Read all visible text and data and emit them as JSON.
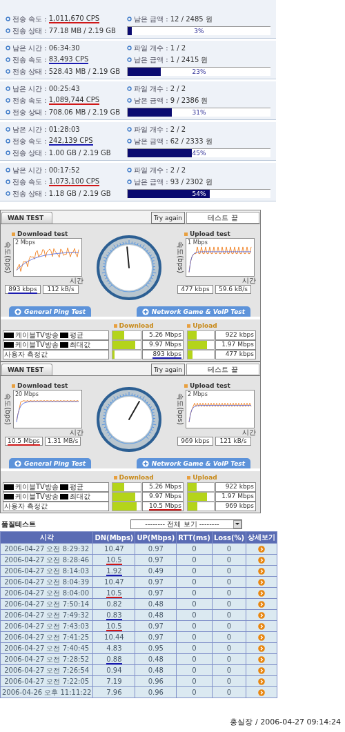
{
  "transfers": [
    {
      "speed_label": "전송 속도 :",
      "speed": {
        "text": "1,011,670 CPS",
        "color": "#d01818"
      },
      "money_label": "남은 금액 :",
      "money": "12 / 2485 원",
      "status_label": "전송 상태 :",
      "status": "77.18 MB / 2.19 GB",
      "level": 0.03,
      "percent": "3%"
    },
    {
      "time_label": "남은 시간 :",
      "time": "06:34:30",
      "files_label": "파일 개수 :",
      "files": "1 / 2",
      "speed_label": "전송 속도 :",
      "speed": {
        "text": "83,493 CPS",
        "color": "#1a1ab0"
      },
      "money_label": "남은 금액 :",
      "money": "1 / 2415 원",
      "status_label": "전송 상태 :",
      "status": "528.43 MB / 2.19 GB",
      "level": 0.23,
      "percent": "23%"
    },
    {
      "time_label": "남은 시간 :",
      "time": "00:25:43",
      "files_label": "파일 개수 :",
      "files": "2 / 2",
      "speed_label": "전송 속도 :",
      "speed": {
        "text": "1,089,744 CPS",
        "color": "#d01818"
      },
      "money_label": "남은 금액 :",
      "money": "9 / 2386 원",
      "status_label": "전송 상태 :",
      "status": "708.06 MB / 2.19 GB",
      "level": 0.31,
      "percent": "31%"
    },
    {
      "time_label": "남은 시간 :",
      "time": "01:28:03",
      "files_label": "파일 개수 :",
      "files": "2 / 2",
      "speed_label": "전송 속도 :",
      "speed": {
        "text": "242,139 CPS",
        "color": "#1a1ab0"
      },
      "money_label": "남은 금액 :",
      "money": "62 / 2333 원",
      "status_label": "전송 상태 :",
      "status": "1.00 GB / 2.19 GB",
      "level": 0.45,
      "percent": "45%"
    },
    {
      "time_label": "남은 시간 :",
      "time": "00:17:52",
      "files_label": "파일 개수 :",
      "files": "2 / 2",
      "speed_label": "전송 속도 :",
      "speed": {
        "text": "1,073,100 CPS",
        "color": "#d01818"
      },
      "money_label": "남은 금액 :",
      "money": "93 / 2302 원",
      "status_label": "전송 상태 :",
      "status": "1.18 GB / 2.19 GB",
      "level": 0.54,
      "percent": "54%"
    }
  ],
  "wan_tests": [
    {
      "tab": "WAN TEST",
      "try_again": "Try again",
      "status": "테스트 끝",
      "gauge": {
        "level": 0.48
      },
      "download": {
        "title": "Download test",
        "scale": "2 Mbps",
        "axis_y": "속도(bps)",
        "axis_x": "시간",
        "kind": "ramp",
        "rate": {
          "text": "893 kbps",
          "color": "#1a1ab0"
        },
        "bytes": "112 kB/s"
      },
      "upload": {
        "title": "Upload test",
        "scale": "1 Mbps",
        "axis_y": "속도(bps)",
        "axis_x": "시간",
        "kind": "pulse",
        "rate": {
          "text": "477 kbps"
        },
        "bytes": "59.6 kB/s"
      },
      "ping_tab": "General Ping Test",
      "game_tab": "Network Game & VoIP Test",
      "download_title": "Download",
      "upload_title": "Upload",
      "rows": [
        {
          "label": "케이블TV방송",
          "suffix": "평균",
          "redacted": true,
          "down": {
            "level": 0.42,
            "text": "5.26 Mbps"
          },
          "up": {
            "level": 0.35,
            "text": "922 kbps"
          }
        },
        {
          "label": "케이블TV방송",
          "suffix": "최대값",
          "redacted": true,
          "down": {
            "level": 0.8,
            "text": "9.97 Mbps"
          },
          "up": {
            "level": 0.75,
            "text": "1.97 Mbps"
          }
        },
        {
          "label": "사용자 측정값",
          "redacted": false,
          "down": {
            "level": 0.07,
            "text": "893 kbps",
            "color": "#1a1ab0"
          },
          "up": {
            "level": 0.18,
            "text": "477 kbps"
          }
        }
      ]
    },
    {
      "tab": "WAN TEST",
      "try_again": "Try again",
      "status": "테스트 끝",
      "gauge": {
        "level": 0.61
      },
      "download": {
        "title": "Download test",
        "scale": "20 Mbps",
        "axis_y": "속도(bps)",
        "axis_x": "시간",
        "kind": "flat",
        "rate": {
          "text": "10.5 Mbps",
          "color": "#d01818"
        },
        "bytes": "1.31 MB/s"
      },
      "upload": {
        "title": "Upload test",
        "scale": "2 Mbps",
        "axis_y": "속도(bps)",
        "axis_x": "시간",
        "kind": "ripple",
        "rate": {
          "text": "969 kbps"
        },
        "bytes": "121 kB/s"
      },
      "ping_tab": "General Ping Test",
      "game_tab": "Network Game & VoIP Test",
      "download_title": "Download",
      "upload_title": "Upload",
      "rows": [
        {
          "label": "케이블TV방송",
          "suffix": "평균",
          "redacted": true,
          "down": {
            "level": 0.42,
            "text": "5.26 Mbps"
          },
          "up": {
            "level": 0.35,
            "text": "922 kbps"
          }
        },
        {
          "label": "케이블TV방송",
          "suffix": "최대값",
          "redacted": true,
          "down": {
            "level": 0.8,
            "text": "9.97 Mbps"
          },
          "up": {
            "level": 0.75,
            "text": "1.97 Mbps"
          }
        },
        {
          "label": "사용자 측정값",
          "redacted": false,
          "down": {
            "level": 0.85,
            "text": "10.5 Mbps",
            "color": "#d01818"
          },
          "up": {
            "level": 0.38,
            "text": "969 kbps"
          }
        }
      ]
    }
  ],
  "quality": {
    "title": "품질테스트",
    "filter": "-------- 전체 보기 --------",
    "columns": [
      "시각",
      "DN(Mbps)",
      "UP(Mbps)",
      "RTT(ms)",
      "Loss(%)",
      "상세보기"
    ],
    "rows": [
      {
        "time": "2006-04-27 오전 8:29:32",
        "dn": {
          "text": "10.47"
        },
        "up": "0.97",
        "rtt": "0",
        "loss": "0"
      },
      {
        "time": "2006-04-27 오전 8:28:46",
        "dn": {
          "text": "10.5",
          "color": "#d01818"
        },
        "up": "0.97",
        "rtt": "0",
        "loss": "0"
      },
      {
        "time": "2006-04-27 오전 8:14:03",
        "dn": {
          "text": "1.92",
          "color": "#1a1ab0"
        },
        "up": "0.49",
        "rtt": "0",
        "loss": "0"
      },
      {
        "time": "2006-04-27 오전 8:04:39",
        "dn": {
          "text": "10.47"
        },
        "up": "0.97",
        "rtt": "0",
        "loss": "0"
      },
      {
        "time": "2006-04-27 오전 8:04:00",
        "dn": {
          "text": "10.5",
          "color": "#d01818"
        },
        "up": "0.97",
        "rtt": "0",
        "loss": "0"
      },
      {
        "time": "2006-04-27 오전 7:50:14",
        "dn": {
          "text": "0.82"
        },
        "up": "0.48",
        "rtt": "0",
        "loss": "0"
      },
      {
        "time": "2006-04-27 오전 7:49:32",
        "dn": {
          "text": "0.83",
          "color": "#1a1ab0"
        },
        "up": "0.48",
        "rtt": "0",
        "loss": "0"
      },
      {
        "time": "2006-04-27 오전 7:43:03",
        "dn": {
          "text": "10.5",
          "color": "#d01818"
        },
        "up": "0.97",
        "rtt": "0",
        "loss": "0"
      },
      {
        "time": "2006-04-27 오전 7:41:25",
        "dn": {
          "text": "10.44"
        },
        "up": "0.97",
        "rtt": "0",
        "loss": "0"
      },
      {
        "time": "2006-04-27 오전 7:40:45",
        "dn": {
          "text": "4.83"
        },
        "up": "0.95",
        "rtt": "0",
        "loss": "0"
      },
      {
        "time": "2006-04-27 오전 7:28:52",
        "dn": {
          "text": "0.88",
          "color": "#1a1ab0"
        },
        "up": "0.48",
        "rtt": "0",
        "loss": "0"
      },
      {
        "time": "2006-04-27 오전 7:26:54",
        "dn": {
          "text": "0.94"
        },
        "up": "0.48",
        "rtt": "0",
        "loss": "0"
      },
      {
        "time": "2006-04-27 오전 7:22:05",
        "dn": {
          "text": "7.19"
        },
        "up": "0.96",
        "rtt": "0",
        "loss": "0"
      },
      {
        "time": "2006-04-26 오후 11:11:22",
        "dn": {
          "text": "7.96"
        },
        "up": "0.96",
        "rtt": "0",
        "loss": "0"
      }
    ]
  },
  "signature": "홍실장 / 2006-04-27 09:14:24"
}
